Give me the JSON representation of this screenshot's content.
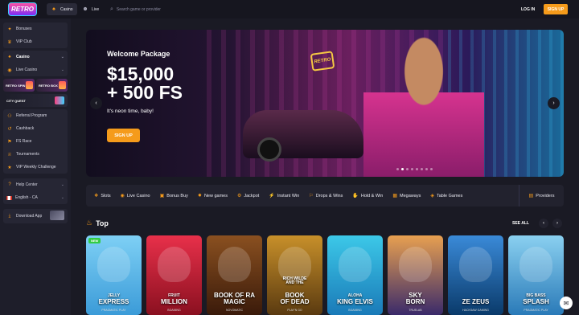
{
  "header": {
    "logo_text": "RETRO",
    "tabs": [
      {
        "label": "Casino",
        "icon": "casino-icon",
        "active": true
      },
      {
        "label": "Live",
        "icon": "live-dealer-icon",
        "active": false
      }
    ],
    "search_placeholder": "Search game or provider",
    "login_label": "LOG IN",
    "signup_label": "SIGN UP"
  },
  "sidebar": {
    "items_group1": [
      {
        "label": "Bonuses",
        "icon": "gift-icon"
      },
      {
        "label": "VIP Club",
        "icon": "crown-icon"
      }
    ],
    "items_group2": [
      {
        "label": "Casino",
        "icon": "casino-icon",
        "chevron": true
      },
      {
        "label": "Live Casino",
        "icon": "live-icon",
        "chevron": true
      }
    ],
    "promos": [
      {
        "label": "RETRO SPIN"
      },
      {
        "label": "RETRO BOX"
      }
    ],
    "promo_wide": "CITY QUEST",
    "items_group3": [
      {
        "label": "Referral Program",
        "icon": "referral-icon"
      },
      {
        "label": "Cashback",
        "icon": "cashback-icon"
      },
      {
        "label": "FS Race",
        "icon": "race-icon"
      },
      {
        "label": "Tournaments",
        "icon": "trophy-icon"
      },
      {
        "label": "VIP Weekly Challenge",
        "icon": "challenge-icon"
      }
    ],
    "help": "Help Center",
    "language": "English - CA",
    "download": "Download App"
  },
  "banner": {
    "subtitle": "Welcome Package",
    "title": "$15,000\n+ 500 FS",
    "tagline": "It's neon time, baby!",
    "cta": "SIGN UP",
    "sign_text": "RETRO",
    "slides": 8,
    "active_slide": 1
  },
  "categories": [
    {
      "label": "Slots",
      "icon": "slots-icon"
    },
    {
      "label": "Live Casino",
      "icon": "live-icon"
    },
    {
      "label": "Bonus Buy",
      "icon": "bonus-buy-icon"
    },
    {
      "label": "New games",
      "icon": "new-icon"
    },
    {
      "label": "Jackpot",
      "icon": "jackpot-icon"
    },
    {
      "label": "Instant Win",
      "icon": "instant-icon"
    },
    {
      "label": "Drops & Wins",
      "icon": "drops-icon"
    },
    {
      "label": "Hold & Win",
      "icon": "hold-icon"
    },
    {
      "label": "Megaways",
      "icon": "megaways-icon"
    },
    {
      "label": "Table Games",
      "icon": "table-icon"
    }
  ],
  "providers_label": "Providers",
  "top": {
    "title": "Top",
    "see_all": "SEE ALL"
  },
  "games": [
    {
      "pre": "JELLY",
      "title": "EXPRESS",
      "provider": "PRAGMATIC PLAY",
      "badge": "NEW",
      "colors": [
        "#3b9bd8",
        "#7ed0f5"
      ]
    },
    {
      "pre": "FRUIT",
      "title": "MILLION",
      "provider": "BGAMING",
      "badge": "",
      "colors": [
        "#8a1020",
        "#e8304a"
      ]
    },
    {
      "pre": "",
      "title": "BOOK OF RA\nMAGIC",
      "provider": "NOVOMATIC",
      "badge": "",
      "colors": [
        "#3a1a0a",
        "#8a5020"
      ]
    },
    {
      "pre": "RICH WILDE\nAND THE",
      "title": "BOOK\nOF DEAD",
      "provider": "PLAY'N GO",
      "badge": "",
      "colors": [
        "#5a3a10",
        "#c8902a"
      ]
    },
    {
      "pre": "ALOHA",
      "title": "KING ELVIS",
      "provider": "BGAMING",
      "badge": "",
      "colors": [
        "#1a7ab8",
        "#3cc8e8"
      ]
    },
    {
      "pre": "",
      "title": "SKY\nBORN",
      "provider": "TRUELAB",
      "badge": "",
      "colors": [
        "#3a2a6a",
        "#e8a050"
      ]
    },
    {
      "pre": "",
      "title": "ZE ZEUS",
      "provider": "HACKSAW GAMING",
      "badge": "",
      "colors": [
        "#0a3a6a",
        "#3a8ad8"
      ]
    },
    {
      "pre": "BIG BASS",
      "title": "SPLASH",
      "provider": "PRAGMATIC PLAY",
      "badge": "",
      "colors": [
        "#2a7ab8",
        "#8ad0f0"
      ]
    }
  ],
  "colors": {
    "accent": "#f59b1b",
    "bg": "#1a1a24",
    "panel": "#22222e"
  }
}
